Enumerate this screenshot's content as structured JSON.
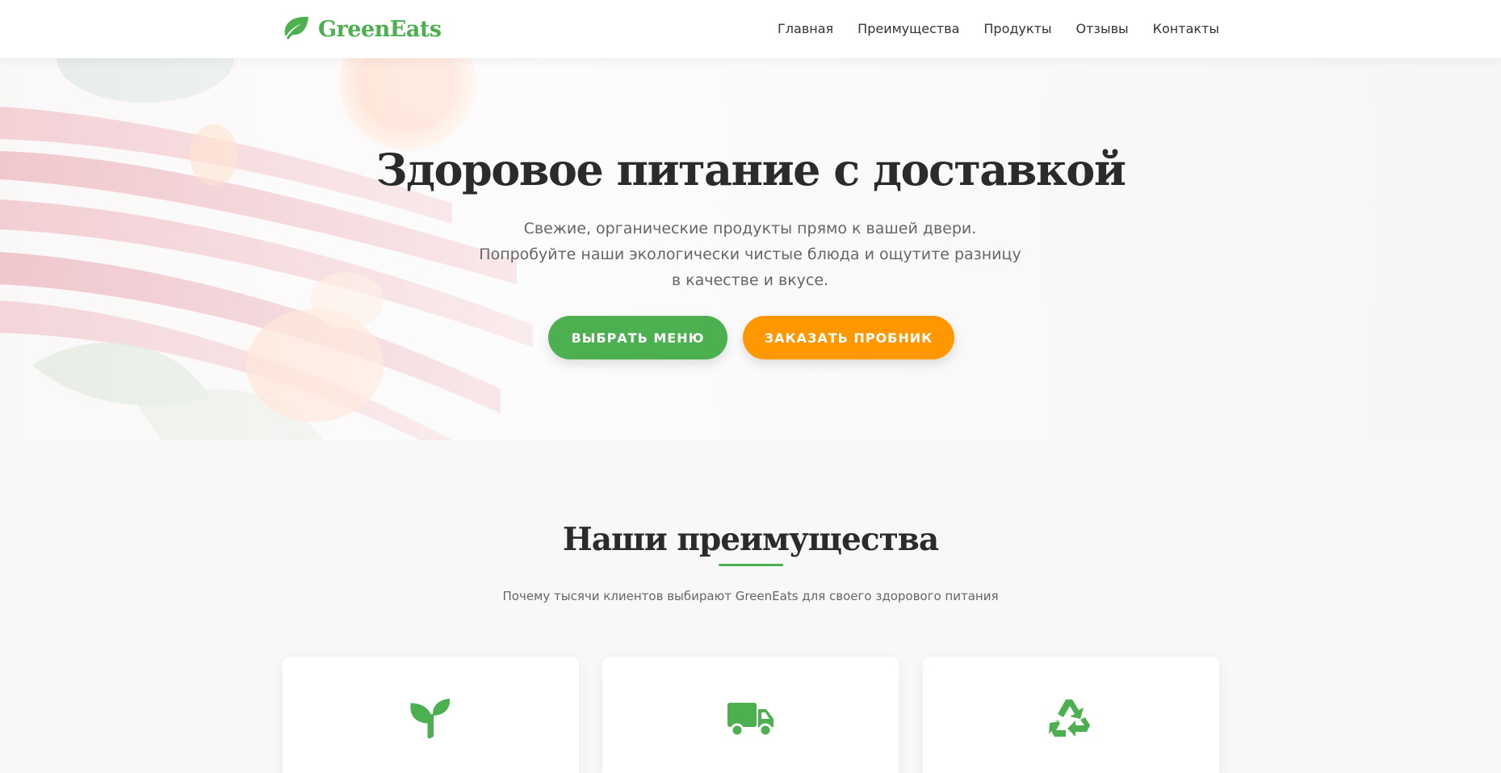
{
  "brand": {
    "name": "GreenEats",
    "icon": "leaf-icon",
    "color": "#4caf50"
  },
  "nav": {
    "items": [
      {
        "label": "Главная"
      },
      {
        "label": "Преимущества"
      },
      {
        "label": "Продукты"
      },
      {
        "label": "Отзывы"
      },
      {
        "label": "Контакты"
      }
    ]
  },
  "hero": {
    "title": "Здоровое питание с доставкой",
    "subtitle_lines": [
      "Свежие, органические продукты прямо к вашей двери.",
      "Попробуйте наши экологически чистые блюда и ощутите разницу",
      "в качестве и вкусе."
    ],
    "primary_button": "ВЫБРАТЬ МЕНЮ",
    "secondary_button": "ЗАКАЗАТЬ ПРОБНИК",
    "primary_color": "#4caf50",
    "secondary_color": "#ff9800"
  },
  "advantages": {
    "title": "Наши преимущества",
    "subtitle": "Почему тысячи клиентов выбирают GreenEats для своего здорового питания",
    "cards": [
      {
        "icon": "seedling-icon"
      },
      {
        "icon": "truck-icon"
      },
      {
        "icon": "recycle-icon"
      }
    ]
  }
}
